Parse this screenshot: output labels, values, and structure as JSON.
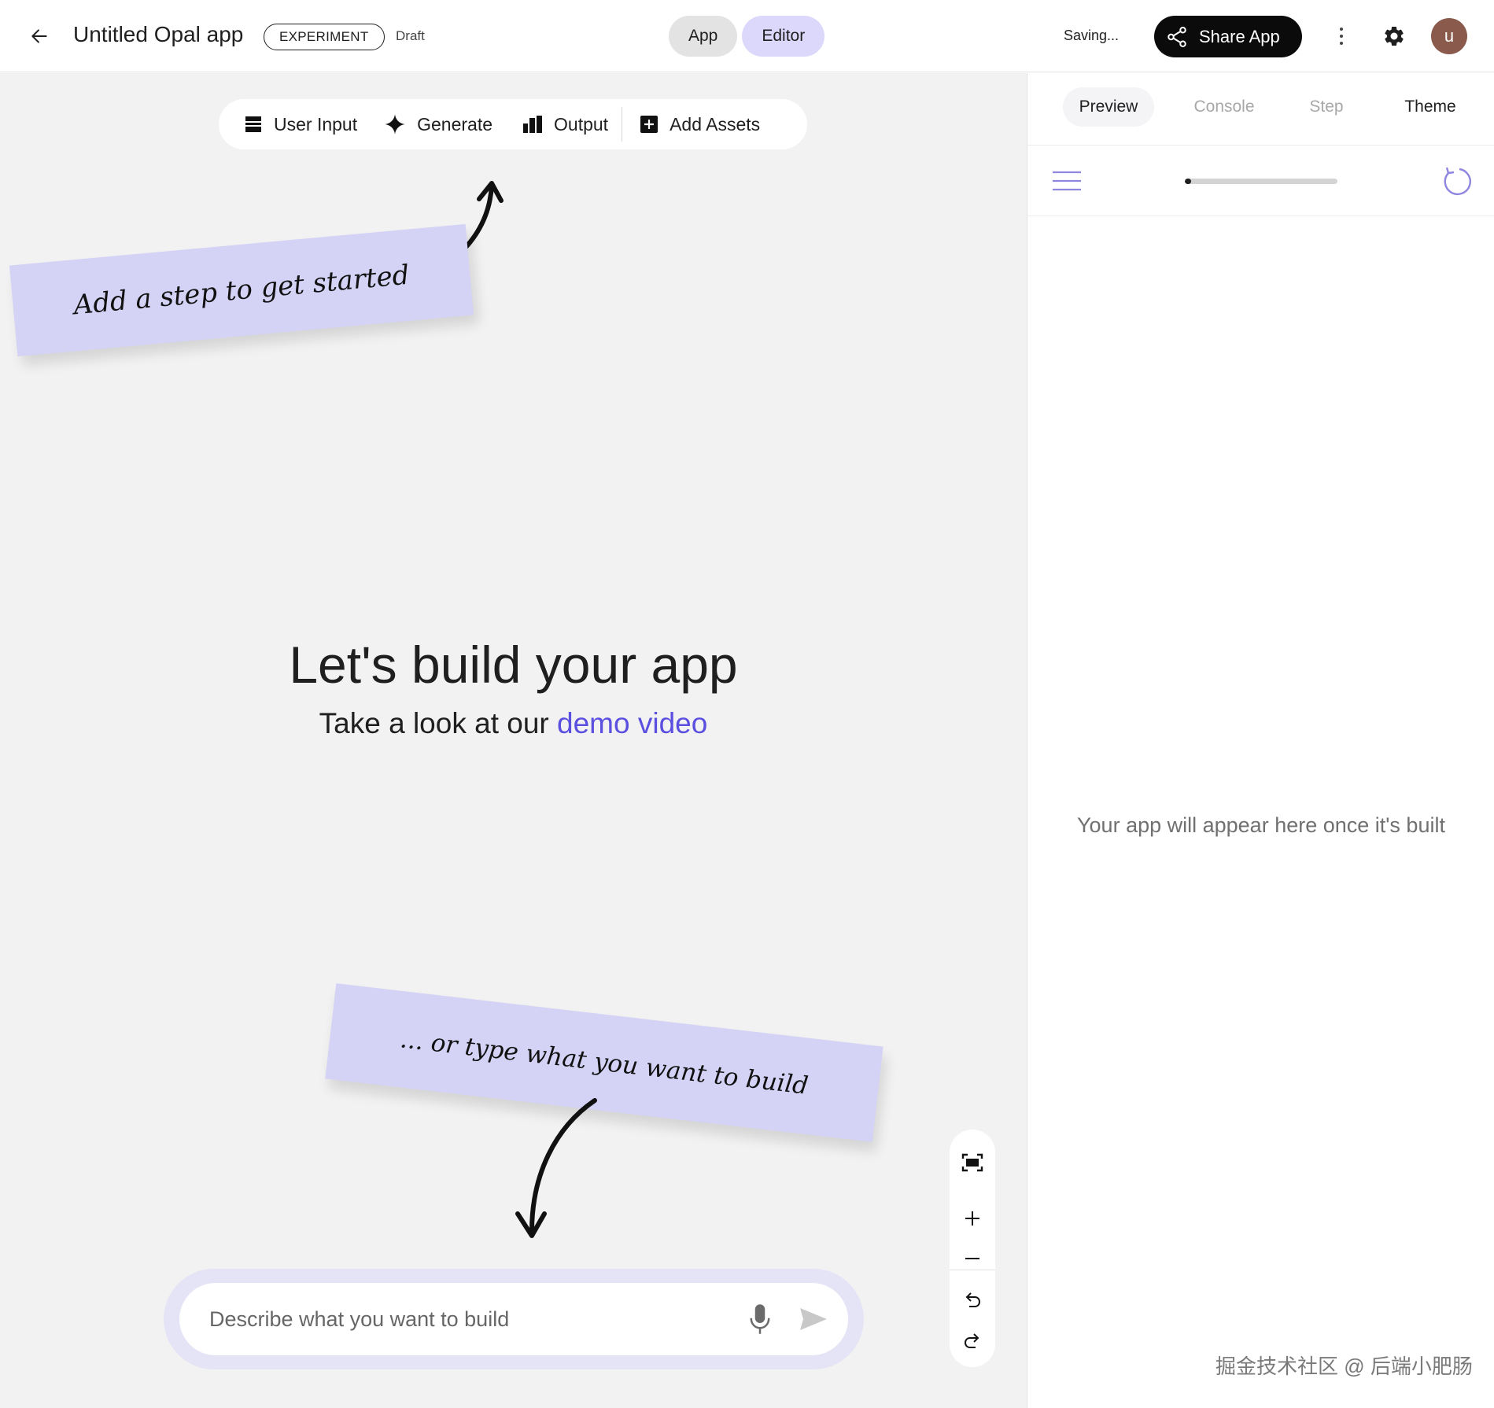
{
  "header": {
    "title": "Untitled Opal app",
    "badge": "EXPERIMENT",
    "status": "Draft",
    "modes": [
      {
        "label": "App"
      },
      {
        "label": "Editor"
      }
    ],
    "saving": "Saving...",
    "share_label": "Share App",
    "avatar_letter": "u"
  },
  "toolbar": {
    "items": [
      {
        "label": "User Input",
        "icon": "user-input-icon"
      },
      {
        "label": "Generate",
        "icon": "sparkle-icon"
      },
      {
        "label": "Output",
        "icon": "output-icon"
      },
      {
        "label": "Add Assets",
        "icon": "add-box-icon"
      }
    ]
  },
  "canvas": {
    "note_top": "Add a step to get started",
    "note_bottom": "... or type what you want to build",
    "hero_title": "Let's build your app",
    "hero_sub_prefix": "Take a look at our ",
    "hero_link": "demo video",
    "prompt_placeholder": "Describe what you want to build"
  },
  "zoom_controls": [
    {
      "name": "fit-view",
      "icon": "fit-screen-icon"
    },
    {
      "name": "zoom-in",
      "icon": "plus-icon"
    },
    {
      "name": "zoom-out",
      "icon": "minus-icon"
    },
    {
      "name": "undo",
      "icon": "undo-icon"
    },
    {
      "name": "redo",
      "icon": "redo-icon"
    }
  ],
  "right_panel": {
    "tabs": [
      {
        "label": "Preview",
        "state": "active"
      },
      {
        "label": "Console",
        "state": "disabled"
      },
      {
        "label": "Step",
        "state": "disabled"
      },
      {
        "label": "Theme",
        "state": "enabled"
      }
    ],
    "progress": 0.04,
    "empty_message": "Your app will appear here once it's built"
  },
  "watermark": "掘金技术社区 @ 后端小肥肠",
  "colors": {
    "accent_purple": "#5b4fe0",
    "editor_pill": "#dcd8fb",
    "note_bg": "#d4d2f5",
    "canvas_bg": "#f2f2f2",
    "share_bg": "#0b0b0b",
    "avatar_bg": "#8a5a4d"
  }
}
